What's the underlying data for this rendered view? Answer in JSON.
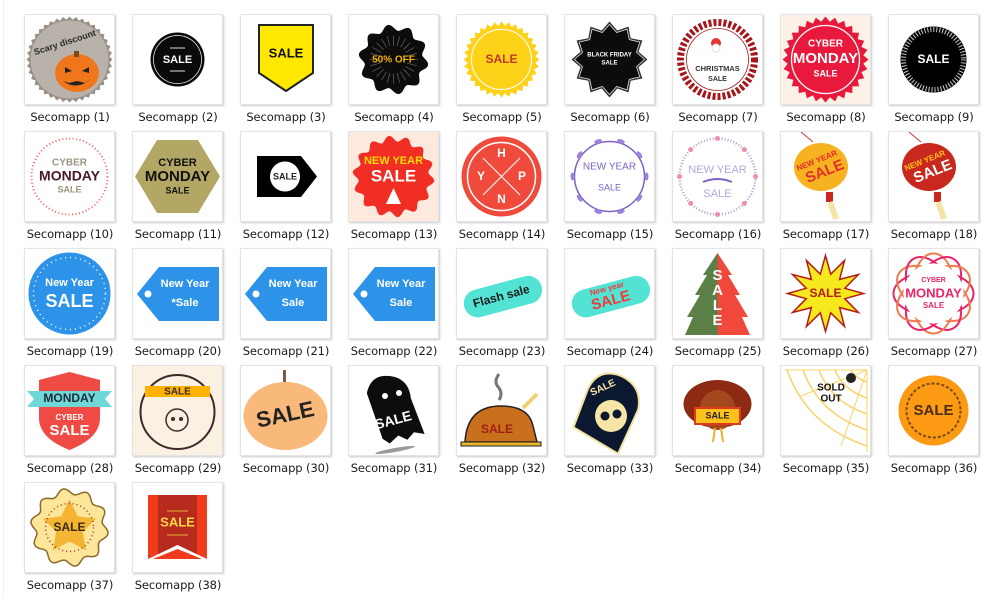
{
  "window": {
    "view": "Large icons"
  },
  "files": [
    {
      "name": "Secomapp (1)",
      "icon": "scary-discount-pumpkin-badge",
      "text": [
        "Scary discount"
      ],
      "colors": {
        "bg": "#b9b2aa",
        "accent": "#f0761c"
      }
    },
    {
      "name": "Secomapp (2)",
      "icon": "black-circle-sale-badge",
      "text": [
        "SALE"
      ],
      "colors": {
        "bg": "#0a0a0a",
        "fg": "#ffffff"
      }
    },
    {
      "name": "Secomapp (3)",
      "icon": "yellow-pennant-sale-badge",
      "text": [
        "SALE"
      ],
      "colors": {
        "bg": "#ffe800",
        "fg": "#111111"
      }
    },
    {
      "name": "Secomapp (4)",
      "icon": "black-burst-50-off-badge",
      "text": [
        "50% OFF"
      ],
      "colors": {
        "bg": "#0c0c0c",
        "fg": "#f2b200"
      }
    },
    {
      "name": "Secomapp (5)",
      "icon": "yellow-seal-sale-badge",
      "text": [
        "SALE"
      ],
      "colors": {
        "bg": "#ffd21a",
        "fg": "#c0392b"
      }
    },
    {
      "name": "Secomapp (6)",
      "icon": "black-friday-sale-badge",
      "text": [
        "BLACK FRIDAY",
        "SALE"
      ],
      "colors": {
        "bg": "#0c0c0c",
        "fg": "#ffffff"
      }
    },
    {
      "name": "Secomapp (7)",
      "icon": "christmas-sale-santa-badge",
      "text": [
        "CHRISTMAS",
        "SALE"
      ],
      "colors": {
        "bg": "#a6171c",
        "fg": "#333333"
      }
    },
    {
      "name": "Secomapp (8)",
      "icon": "cyber-monday-red-seal-badge",
      "text": [
        "CYBER",
        "MONDAY",
        "SALE"
      ],
      "colors": {
        "bg": "#e8193c",
        "fg": "#ffffff",
        "page": "#fbf1e6"
      }
    },
    {
      "name": "Secomapp (9)",
      "icon": "black-mosaic-sale-badge",
      "text": [
        "SALE"
      ],
      "colors": {
        "bg": "#000000",
        "fg": "#ffffff"
      }
    },
    {
      "name": "Secomapp (10)",
      "icon": "cyber-monday-dotted-circle-badge",
      "text": [
        "CYBER",
        "MONDAY",
        "SALE"
      ],
      "colors": {
        "fg": "#4a1a2c",
        "muted": "#9c9480",
        "dots": "#f06262"
      }
    },
    {
      "name": "Secomapp (11)",
      "icon": "cyber-monday-hexagon-badge",
      "text": [
        "CYBER",
        "MONDAY",
        "SALE"
      ],
      "colors": {
        "bg": "#b3a765",
        "fg": "#111111"
      }
    },
    {
      "name": "Secomapp (12)",
      "icon": "black-arrow-tag-sale-badge",
      "text": [
        "SALE"
      ],
      "colors": {
        "bg": "#000000",
        "fg": "#222222"
      }
    },
    {
      "name": "Secomapp (13)",
      "icon": "new-year-sale-red-seal-badge",
      "text": [
        "NEW YEAR",
        "SALE"
      ],
      "colors": {
        "bg": "#f02e24",
        "fg": "#ffffff",
        "accent": "#ffdd00",
        "page": "#fde9de"
      }
    },
    {
      "name": "Secomapp (14)",
      "icon": "hnyp-red-circle-badge",
      "text": [
        "H",
        "Y",
        "P",
        "N"
      ],
      "colors": {
        "bg": "#f04a3c",
        "fg": "#ffffff"
      }
    },
    {
      "name": "Secomapp (15)",
      "icon": "new-year-sale-laurel-badge",
      "text": [
        "NEW YEAR",
        "SALE"
      ],
      "colors": {
        "fg": "#7b61c4",
        "accent": "#e87aa0"
      }
    },
    {
      "name": "Secomapp (16)",
      "icon": "new-year-sale-floral-wreath-badge",
      "text": [
        "NEW YEAR",
        "SALE"
      ],
      "colors": {
        "fg": "#b3a8dc",
        "accent": "#f08cac"
      }
    },
    {
      "name": "Secomapp (17)",
      "icon": "new-year-sale-yellow-lantern",
      "text": [
        "NEW YEAR",
        "SALE"
      ],
      "colors": {
        "bg": "#f7b21f",
        "fg": "#e02e2e"
      }
    },
    {
      "name": "Secomapp (18)",
      "icon": "new-year-sale-red-lantern",
      "text": [
        "NEW YEAR",
        "SALE"
      ],
      "colors": {
        "bg": "#c8281e",
        "fg": "#ffffff",
        "accent": "#ffc21a"
      }
    },
    {
      "name": "Secomapp (19)",
      "icon": "new-year-sale-blue-circle",
      "text": [
        "New Year",
        "SALE"
      ],
      "colors": {
        "bg": "#2d93e8",
        "fg": "#ffffff"
      }
    },
    {
      "name": "Secomapp (20)",
      "icon": "new-year-sale-blue-tag-stars",
      "text": [
        "New Year",
        "*Sale"
      ],
      "colors": {
        "bg": "#2d93e8",
        "fg": "#ffffff"
      }
    },
    {
      "name": "Secomapp (21)",
      "icon": "new-year-sale-blue-tag-burst",
      "text": [
        "New Year",
        "Sale"
      ],
      "colors": {
        "bg": "#2d93e8",
        "fg": "#ffffff"
      }
    },
    {
      "name": "Secomapp (22)",
      "icon": "new-year-sale-blue-tag-diamonds",
      "text": [
        "New Year",
        "Sale"
      ],
      "colors": {
        "bg": "#2d93e8",
        "fg": "#ffffff"
      }
    },
    {
      "name": "Secomapp (23)",
      "icon": "flash-sale-teal-pill",
      "text": [
        "Flash sale"
      ],
      "colors": {
        "bg": "#3fe0d0",
        "fg": "#1a1a1a"
      }
    },
    {
      "name": "Secomapp (24)",
      "icon": "new-year-sale-teal-pill",
      "text": [
        "New year",
        "SALE"
      ],
      "colors": {
        "bg": "#3fe0d0",
        "fg": "#f03a3a"
      }
    },
    {
      "name": "Secomapp (25)",
      "icon": "christmas-tree-sale-badge",
      "text": [
        "SALE"
      ],
      "colors": {
        "left": "#5a8048",
        "right": "#f0483a",
        "fg": "#ffffff"
      }
    },
    {
      "name": "Secomapp (26)",
      "icon": "yellow-starburst-sale-badge",
      "text": [
        "SALE"
      ],
      "colors": {
        "bg": "#f5e81c",
        "fg": "#b31c16"
      }
    },
    {
      "name": "Secomapp (27)",
      "icon": "cyber-monday-pink-ribbon-badge",
      "text": [
        "CYBER",
        "MONDAY",
        "SALE"
      ],
      "colors": {
        "fg": "#e8246a",
        "accent": "#f07a50"
      }
    },
    {
      "name": "Secomapp (28)",
      "icon": "monday-cyber-sale-shield-badge",
      "text": [
        "MONDAY",
        "CYBER",
        "SALE"
      ],
      "colors": {
        "bg": "#ef4a43",
        "ribbon": "#6fd8d6",
        "fg": "#ffffff"
      }
    },
    {
      "name": "Secomapp (29)",
      "icon": "skull-sale-ribbon-badge",
      "text": [
        "SALE"
      ],
      "colors": {
        "bg": "#fbf1e3",
        "ribbon": "#ffb300",
        "fg": "#3a2a2a"
      }
    },
    {
      "name": "Secomapp (30)",
      "icon": "pumpkin-sale-badge",
      "text": [
        "SALE"
      ],
      "colors": {
        "bg": "#f8b97a",
        "fg": "#222222"
      }
    },
    {
      "name": "Secomapp (31)",
      "icon": "ghost-sale-badge",
      "text": [
        "SALE"
      ],
      "colors": {
        "bg": "#0d0d0d",
        "fg": "#ffffff"
      }
    },
    {
      "name": "Secomapp (32)",
      "icon": "roast-turkey-sale-badge",
      "text": [
        "SALE"
      ],
      "colors": {
        "bg": "#c8701c",
        "fg": "#a31d16"
      }
    },
    {
      "name": "Secomapp (33)",
      "icon": "skull-tombstone-sale-badge",
      "text": [
        "SALE"
      ],
      "colors": {
        "bg": "#0c1830",
        "fg": "#f5e5a6"
      }
    },
    {
      "name": "Secomapp (34)",
      "icon": "turkey-sale-sign-badge",
      "text": [
        "SALE"
      ],
      "colors": {
        "bg": "#8c2a14",
        "sign": "#ffc21a"
      }
    },
    {
      "name": "Secomapp (35)",
      "icon": "sold-out-spiderweb-badge",
      "text": [
        "SOLD",
        "OUT"
      ],
      "colors": {
        "web": "#f8d36a",
        "fg": "#111111"
      }
    },
    {
      "name": "Secomapp (36)",
      "icon": "orange-wreath-sale-badge",
      "text": [
        "SALE"
      ],
      "colors": {
        "bg": "#fc9a14",
        "fg": "#4a2e12"
      }
    },
    {
      "name": "Secomapp (37)",
      "icon": "autumn-leaf-sale-badge",
      "text": [
        "SALE"
      ],
      "colors": {
        "bg": "#fde69a",
        "leaf": "#f3b533",
        "fg": "#3a2a0a"
      }
    },
    {
      "name": "Secomapp (38)",
      "icon": "red-banner-sale-badge",
      "text": [
        "SALE"
      ],
      "colors": {
        "bg": "#f03c1c",
        "inner": "#b72a1e",
        "fg": "#ffd84a"
      }
    }
  ]
}
